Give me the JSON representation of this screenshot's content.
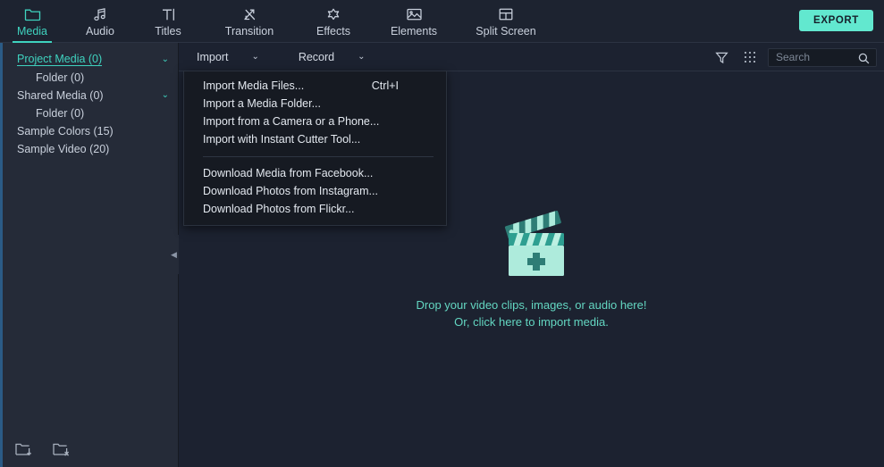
{
  "app": {
    "accent": "#3fd3bf",
    "bg": "#1c2230",
    "sidebar_bg": "#252b38",
    "menu_bg": "#161a22"
  },
  "toolbar": {
    "items": [
      {
        "label": "Media",
        "icon": "folder-icon",
        "active": true
      },
      {
        "label": "Audio",
        "icon": "music-note-icon",
        "active": false
      },
      {
        "label": "Titles",
        "icon": "text-cursor-icon",
        "active": false
      },
      {
        "label": "Transition",
        "icon": "transition-arrows-icon",
        "active": false
      },
      {
        "label": "Effects",
        "icon": "sparkle-star-icon",
        "active": false
      },
      {
        "label": "Elements",
        "icon": "image-icon",
        "active": false
      },
      {
        "label": "Split Screen",
        "icon": "split-screen-grid-icon",
        "active": false
      }
    ],
    "export_label": "EXPORT"
  },
  "sidebar": {
    "items": [
      {
        "label": "Project Media (0)",
        "indent": 0,
        "chevron": "⌄",
        "active": true
      },
      {
        "label": "Folder (0)",
        "indent": 1,
        "chevron": "",
        "active": false
      },
      {
        "label": "Shared Media (0)",
        "indent": 0,
        "chevron": "⌄",
        "active": false
      },
      {
        "label": "Folder (0)",
        "indent": 1,
        "chevron": "",
        "active": false
      },
      {
        "label": "Sample Colors (15)",
        "indent": 0,
        "chevron": "",
        "active": false
      },
      {
        "label": "Sample Video (20)",
        "indent": 0,
        "chevron": "",
        "active": false
      }
    ],
    "collapse_arrow": "◀",
    "footer": {
      "new_folder_icon": "folder-plus-icon",
      "delete_folder_icon": "folder-delete-icon"
    }
  },
  "mediabar": {
    "import_label": "Import",
    "import_chevron": "⌄",
    "record_label": "Record",
    "record_chevron": "⌄",
    "filter_icon": "filter-funnel-icon",
    "grid_icon": "grid-view-icon",
    "search": {
      "placeholder": "Search",
      "value": "",
      "icon": "search-icon"
    }
  },
  "import_menu": {
    "groups": [
      {
        "items": [
          {
            "label": "Import Media Files...",
            "accel": "Ctrl+I"
          },
          {
            "label": "Import a Media Folder...",
            "accel": ""
          },
          {
            "label": "Import from a Camera or a Phone...",
            "accel": ""
          },
          {
            "label": "Import with Instant Cutter Tool...",
            "accel": ""
          }
        ]
      },
      {
        "items": [
          {
            "label": "Download Media from Facebook...",
            "accel": ""
          },
          {
            "label": "Download Photos from Instagram...",
            "accel": ""
          },
          {
            "label": "Download Photos from Flickr...",
            "accel": ""
          }
        ]
      }
    ]
  },
  "dropzone": {
    "icon": "clapperboard-add-icon",
    "line1": "Drop your video clips, images, or audio here!",
    "line2": "Or, click here to import media."
  }
}
